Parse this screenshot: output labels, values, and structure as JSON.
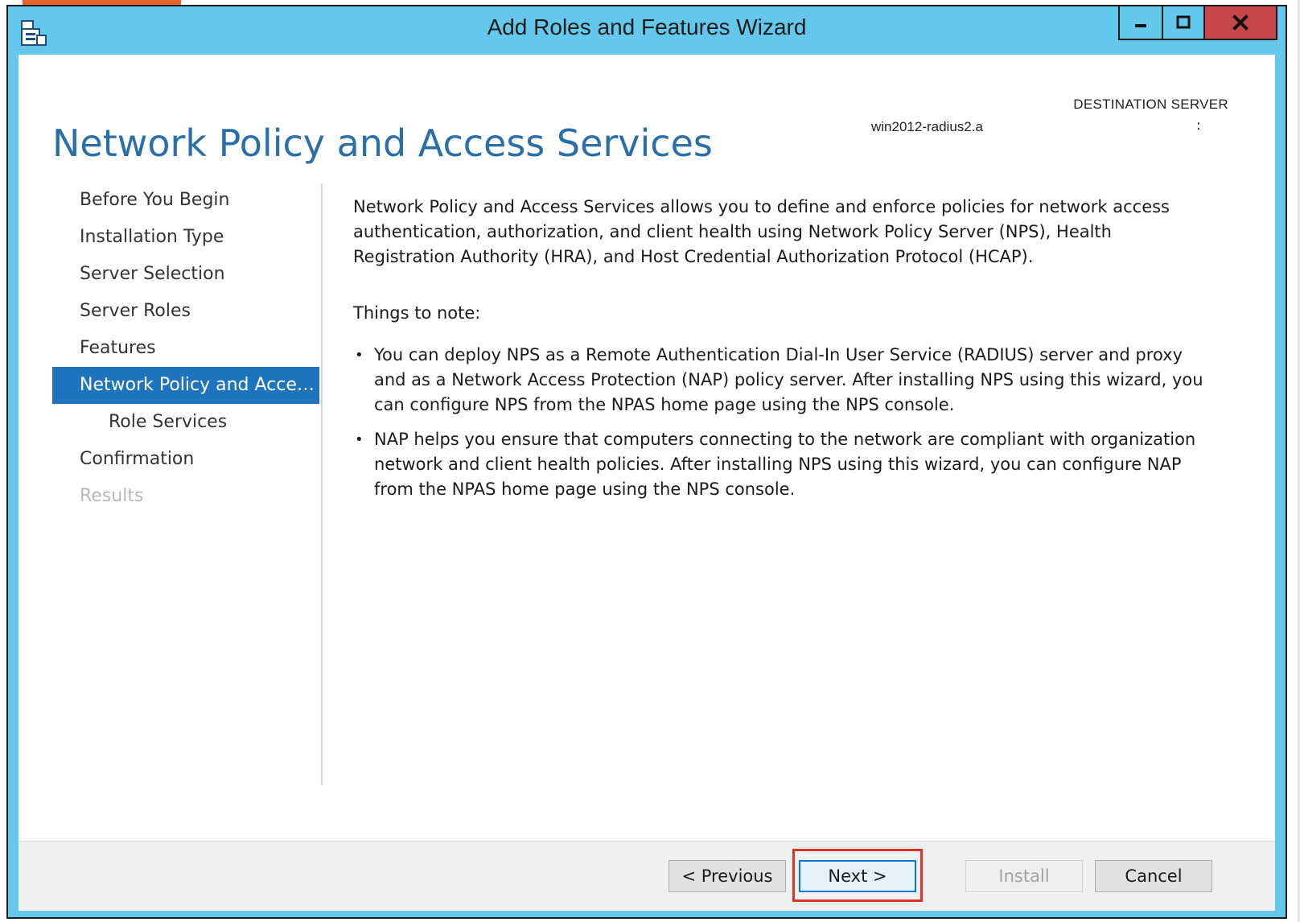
{
  "window": {
    "title": "Add Roles and Features Wizard",
    "controls": {
      "minimize": "minimize-icon",
      "maximize": "maximize-icon",
      "close": "close-icon"
    }
  },
  "header": {
    "page_title": "Network Policy and Access Services",
    "destination_label": "DESTINATION SERVER",
    "destination_server": "win2012-radius2.a",
    "destination_suffix": ":"
  },
  "nav": {
    "items": [
      {
        "label": "Before You Begin",
        "state": "normal"
      },
      {
        "label": "Installation Type",
        "state": "normal"
      },
      {
        "label": "Server Selection",
        "state": "normal"
      },
      {
        "label": "Server Roles",
        "state": "normal"
      },
      {
        "label": "Features",
        "state": "normal"
      },
      {
        "label": "Network Policy and Acces...",
        "state": "active"
      },
      {
        "label": "Role Services",
        "state": "sub"
      },
      {
        "label": "Confirmation",
        "state": "normal"
      },
      {
        "label": "Results",
        "state": "disabled"
      }
    ]
  },
  "content": {
    "intro": "Network Policy and Access Services allows you to define and enforce policies for network access authentication, authorization, and client health using Network Policy Server (NPS), Health Registration Authority (HRA), and Host Credential Authorization Protocol (HCAP).",
    "notes_heading": "Things to note:",
    "bullets": [
      "You can deploy NPS as a Remote Authentication Dial-In User Service (RADIUS) server and proxy and as a Network Access Protection (NAP) policy server. After installing NPS using this wizard, you can configure NPS from the NPAS home page using the NPS console.",
      "NAP helps you ensure that computers connecting to the network are compliant with organization network and client health policies. After installing NPS using this wizard, you can configure NAP from the NPAS home page using the NPS console."
    ],
    "bullet_glyph": "•"
  },
  "footer": {
    "previous_label": "< Previous",
    "next_label": "Next >",
    "install_label": "Install",
    "cancel_label": "Cancel"
  },
  "colors": {
    "window_frame": "#63c8eb",
    "title_accent": "#2a6fa8",
    "nav_active": "#1f74c0",
    "close_button": "#c8474a",
    "highlight": "#e0312d"
  }
}
